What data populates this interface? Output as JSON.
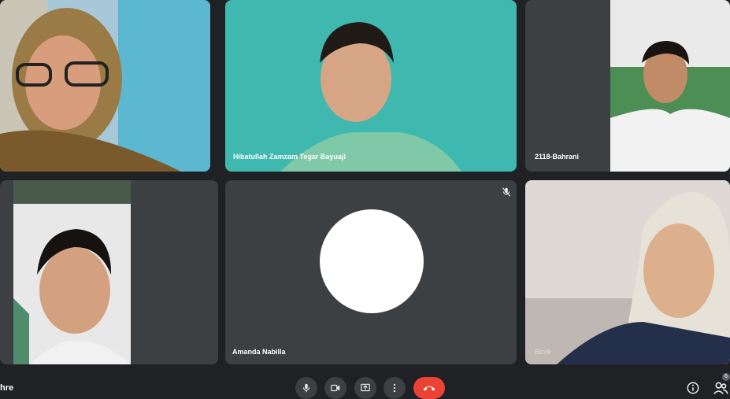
{
  "participants": [
    {
      "id": "p1",
      "name": ""
    },
    {
      "id": "p2",
      "name": "Hibatullah Zamzam Tegar Bayuaji"
    },
    {
      "id": "p3",
      "name": "2118-Bahrani"
    },
    {
      "id": "p4",
      "name": ""
    },
    {
      "id": "p5",
      "name": "Amanda Nabilla"
    },
    {
      "id": "p6",
      "name": "Bindi"
    }
  ],
  "meeting": {
    "name_fragment": "hre"
  },
  "participant_count": "6",
  "colors": {
    "tile_bg": "#3c4043",
    "page_bg": "#202124",
    "hangup": "#ea4335"
  },
  "icons": {
    "mic": "mic-icon",
    "camera": "camera-icon",
    "present": "present-icon",
    "more": "more-options-icon",
    "hangup": "hang-up-icon",
    "info": "info-icon",
    "people": "people-icon"
  }
}
